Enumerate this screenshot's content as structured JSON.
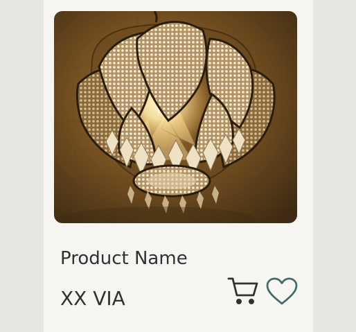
{
  "product": {
    "name": "Product Name",
    "price": "XX VIA",
    "image_alt": "crystal-beaded-lotus-pendant-lamp"
  },
  "icons": {
    "cart": "shopping-cart-icon",
    "favorite": "heart-outline-icon"
  },
  "colors": {
    "page_background": "#e6e5e1",
    "card_background": "#f7f5f1",
    "text": "#2f3233",
    "cart_icon": "#2f3233",
    "heart_icon": "#3f6e68"
  }
}
